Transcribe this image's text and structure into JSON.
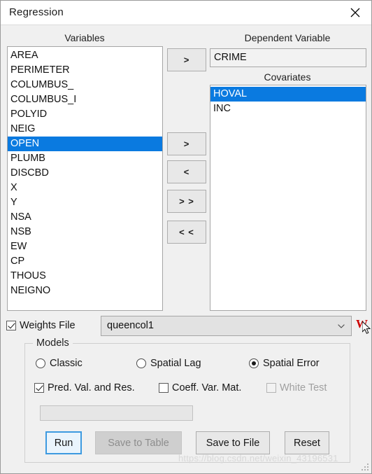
{
  "window": {
    "title": "Regression",
    "close_icon": "close-icon"
  },
  "variables_panel": {
    "caption": "Variables",
    "items": [
      {
        "label": "AREA",
        "selected": false
      },
      {
        "label": "PERIMETER",
        "selected": false
      },
      {
        "label": "COLUMBUS_",
        "selected": false
      },
      {
        "label": "COLUMBUS_I",
        "selected": false
      },
      {
        "label": "POLYID",
        "selected": false
      },
      {
        "label": "NEIG",
        "selected": false
      },
      {
        "label": "OPEN",
        "selected": true
      },
      {
        "label": "PLUMB",
        "selected": false
      },
      {
        "label": "DISCBD",
        "selected": false
      },
      {
        "label": "X",
        "selected": false
      },
      {
        "label": "Y",
        "selected": false
      },
      {
        "label": "NSA",
        "selected": false
      },
      {
        "label": "NSB",
        "selected": false
      },
      {
        "label": "EW",
        "selected": false
      },
      {
        "label": "CP",
        "selected": false
      },
      {
        "label": "THOUS",
        "selected": false
      },
      {
        "label": "NEIGNO",
        "selected": false
      }
    ]
  },
  "dependent_variable": {
    "caption": "Dependent Variable",
    "value": "CRIME"
  },
  "covariates_panel": {
    "caption": "Covariates",
    "items": [
      {
        "label": "HOVAL",
        "selected": true
      },
      {
        "label": "INC",
        "selected": false
      }
    ]
  },
  "transfer_buttons": {
    "dependent_add": ">",
    "covariate_add": ">",
    "covariate_remove": "<",
    "covariate_add_all": "> >",
    "covariate_remove_all": "< <"
  },
  "weights": {
    "checkbox_label": "Weights File",
    "checked": true,
    "selected_file": "queencol1",
    "dropdown_icon": "chevron-down-icon",
    "w_icon_label": "W"
  },
  "models": {
    "legend": "Models",
    "radios": [
      {
        "label": "Classic",
        "selected": false
      },
      {
        "label": "Spatial Lag",
        "selected": false
      },
      {
        "label": "Spatial Error",
        "selected": true
      }
    ],
    "checkboxes": [
      {
        "label": "Pred. Val. and Res.",
        "checked": true,
        "disabled": false
      },
      {
        "label": "Coeff. Var. Mat.",
        "checked": false,
        "disabled": false
      },
      {
        "label": "White Test",
        "checked": false,
        "disabled": true
      }
    ],
    "progress_value": ""
  },
  "actions": {
    "run": "Run",
    "save_to_table": "Save to Table",
    "save_to_file": "Save to File",
    "reset": "Reset"
  },
  "watermark": {
    "text": "https://blog.csdn.net/weixin_43196531"
  },
  "colors": {
    "selection_blue": "#0a7ae0",
    "accent_focus": "#3d9ae0",
    "dialog_bg": "#f0f0f0",
    "w_icon_red": "#cc0000",
    "disabled_text": "#8d8d8d"
  }
}
